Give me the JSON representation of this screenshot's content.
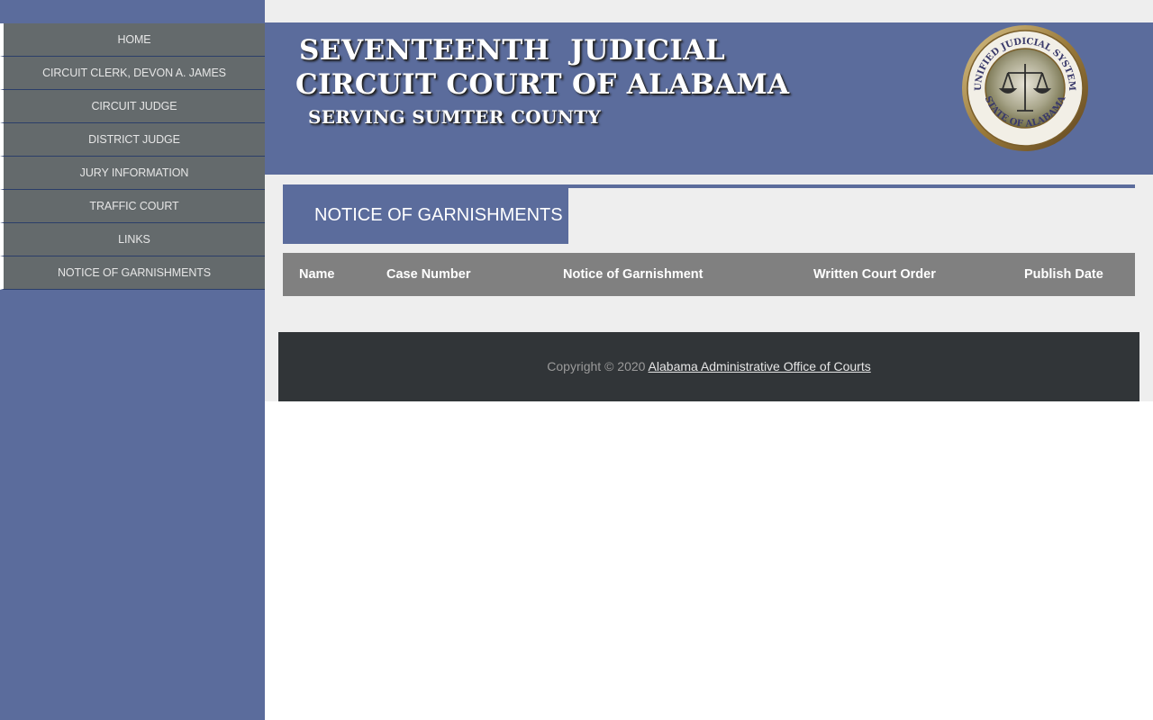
{
  "sidebar": {
    "items": [
      {
        "label": "HOME"
      },
      {
        "label": "CIRCUIT CLERK, DEVON A. JAMES"
      },
      {
        "label": "CIRCUIT JUDGE"
      },
      {
        "label": "DISTRICT JUDGE"
      },
      {
        "label": "JURY INFORMATION"
      },
      {
        "label": "TRAFFIC COURT"
      },
      {
        "label": "LINKS"
      },
      {
        "label": "NOTICE OF GARNISHMENTS"
      }
    ]
  },
  "banner": {
    "line1": "SEVENTEENTH  JUDICIAL",
    "line2": "CIRCUIT COURT OF ALABAMA",
    "line3": "SERVING SUMTER COUNTY",
    "seal_top": "UNIFIED JUDICIAL SYSTEM",
    "seal_bottom": "STATE OF ALABAMA"
  },
  "page": {
    "title": "NOTICE OF GARNISHMENTS"
  },
  "table": {
    "columns": [
      "Name",
      "Case Number",
      "Notice of Garnishment",
      "Written Court Order",
      "Publish Date"
    ]
  },
  "footer": {
    "copyright": "Copyright © 2020",
    "link_text": "Alabama Administrative Office of Courts"
  },
  "colors": {
    "brand_blue": "#5b6c9c",
    "nav_gray": "#646a6c",
    "table_head": "#808080",
    "footer_bg": "#313538"
  }
}
